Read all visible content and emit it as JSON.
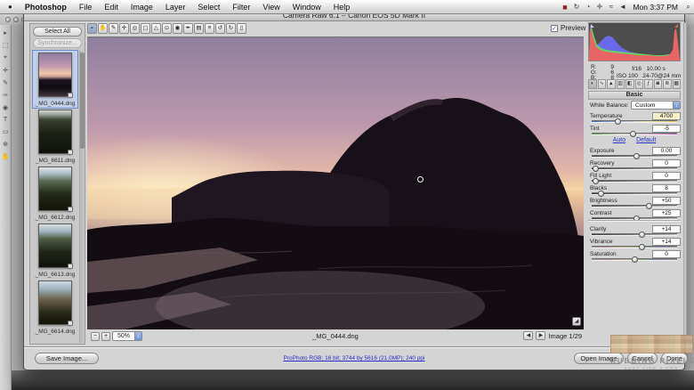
{
  "menubar": {
    "apple_glyph": "●",
    "menus": [
      "Photoshop",
      "File",
      "Edit",
      "Image",
      "Layer",
      "Select",
      "Filter",
      "View",
      "Window",
      "Help"
    ],
    "status_glyphs": {
      "app": "■",
      "sync": "↻",
      "timemachine": "◔",
      "display": "✛",
      "wifi": "≈",
      "volume": "◄",
      "spotlight": "⌕"
    },
    "clock": "Mon 3:37 PM"
  },
  "ps_tools": [
    "▸",
    "⬚",
    "⌖",
    "✛",
    "✎",
    "✑",
    "◉",
    "T",
    "▭",
    "⊕",
    "✋"
  ],
  "dialog": {
    "title": "Camera Raw 6.1  –  Canon EOS 5D Mark II",
    "toolbar": {
      "tools": [
        "⌕",
        "✋",
        "✎",
        "✛",
        "◎",
        "▢",
        "△",
        "⊙",
        "◉",
        "✒",
        "▤",
        "≡",
        "↺",
        "↻",
        "▯"
      ],
      "preview_label": "Preview"
    },
    "ui": {
      "check": "✓",
      "stepper": "↕",
      "corner": "◢",
      "zoom_out": "−",
      "zoom_in": "+",
      "nav_prev": "◀",
      "nav_next": "▶"
    },
    "filmstrip": {
      "select_all": "Select All",
      "synchronize": "Synchronize...",
      "thumbs": [
        {
          "label": "_MG_0444.dng"
        },
        {
          "label": "_MG_6611.dng"
        },
        {
          "label": "_MG_6612.dng"
        },
        {
          "label": "_MG_6613.dng"
        },
        {
          "label": "_MG_6614.dng"
        }
      ]
    },
    "preview": {
      "zoom": "50%",
      "filename": "_MG_0444.dng",
      "count": "Image 1/29"
    },
    "histogram": {
      "r_label": "R:",
      "r": "9",
      "g_label": "G:",
      "g": "6",
      "b_label": "B:",
      "b": "8",
      "line1": "f/16   10.00 s",
      "line2": "ISO 100   24-70@24 mm"
    },
    "tabs": [
      "◐",
      "∿",
      "▲",
      "▥",
      "◧",
      "◎",
      "ƒ",
      "◙",
      "≣",
      "▦"
    ],
    "basic": {
      "title": "Basic",
      "wb_label": "White Balance:",
      "wb_value": "Custom",
      "auto": "Auto",
      "default": "Default",
      "sliders": [
        {
          "label": "Temperature",
          "value": "4700",
          "pos": "30%"
        },
        {
          "label": "Tint",
          "value": "-5",
          "pos": "48%"
        },
        {
          "label": "Exposure",
          "value": "0.00",
          "pos": "52%"
        },
        {
          "label": "Recovery",
          "value": "0",
          "pos": "4%"
        },
        {
          "label": "Fill Light",
          "value": "0",
          "pos": "4%"
        },
        {
          "label": "Blacks",
          "value": "8",
          "pos": "10%"
        },
        {
          "label": "Brightness",
          "value": "+50",
          "pos": "67%"
        },
        {
          "label": "Contrast",
          "value": "+25",
          "pos": "52%"
        },
        {
          "label": "Clarity",
          "value": "+14",
          "pos": "58%"
        },
        {
          "label": "Vibrance",
          "value": "+14",
          "pos": "58%"
        },
        {
          "label": "Saturation",
          "value": "0",
          "pos": "50%"
        }
      ]
    },
    "bottom": {
      "save": "Save Image...",
      "workflow": "ProPhoto RGB; 16 bit; 3744 by 5616 (21.0MP); 240 ppi",
      "open": "Open Image",
      "cancel": "Cancel",
      "done": "Done"
    }
  },
  "watermark": {
    "title": "RUBBING PIXELS",
    "subtitle": "JUST LIKE A PRO"
  }
}
